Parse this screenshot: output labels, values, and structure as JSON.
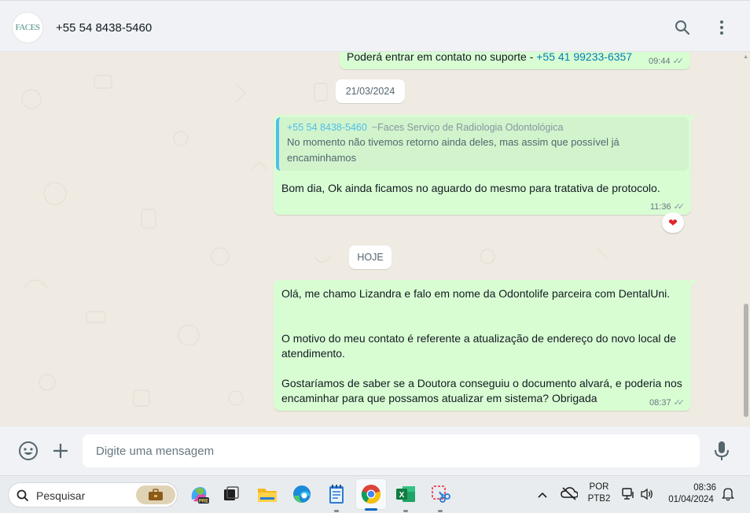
{
  "header": {
    "avatar_text": "FACES",
    "contact_name": "+55 54 8438-5460",
    "icons": [
      "search-icon",
      "menu-icon"
    ]
  },
  "messages": {
    "partial_top": {
      "text_prefix": "Poderá entrar em contato no suporte - ",
      "phone_link": "+55 41 99233-6357",
      "time": "09:44"
    },
    "date_1": "21/03/2024",
    "reply_msg": {
      "quote_author": "+55 54 8438-5460",
      "quote_sender": "~Faces Serviço de Radiologia Odontológica",
      "quote_text_line1": "No momento não tivemos retorno ainda deles, mas assim que possível já",
      "quote_text_line2": "encaminhamos",
      "text": "Bom dia, Ok ainda ficamos no aguardo do mesmo para tratativa de protocolo.",
      "time": "11:36",
      "reaction": "❤"
    },
    "date_2": "HOJE",
    "last_msg": {
      "line1": "Olá, me chamo Lizandra e falo em nome da Odontolife parceira com DentalUni.",
      "line2": "O motivo do meu contato é referente a atualização de endereço do novo local de",
      "line3": "atendimento.",
      "line4": "Gostaríamos de saber se a Doutora conseguiu o documento alvará, e poderia nos",
      "line5": "encaminhar para que possamos atualizar em sistema? Obrigada",
      "time": "08:37"
    },
    "tick_glyph": "✓✓"
  },
  "compose": {
    "placeholder": "Digite uma mensagem",
    "icons": [
      "emoji-icon",
      "plus-icon",
      "microphone-icon"
    ]
  },
  "taskbar": {
    "search_label": "Pesquisar",
    "apps": [
      "briefcase-icon",
      "copilot-pre-icon",
      "task-view-icon",
      "file-explorer-icon",
      "edge-icon",
      "notepad-icon",
      "chrome-icon",
      "excel-icon",
      "snipping-tool-icon"
    ],
    "language_top": "POR",
    "language_bottom": "PTB2",
    "time": "08:36",
    "date": "01/04/2024"
  },
  "colors": {
    "outgoing_bubble": "#d9fdd3",
    "chat_background": "#efeae2",
    "link": "#027eb5",
    "quote_accent": "#53bdeb",
    "header_background": "#f0f2f5"
  }
}
